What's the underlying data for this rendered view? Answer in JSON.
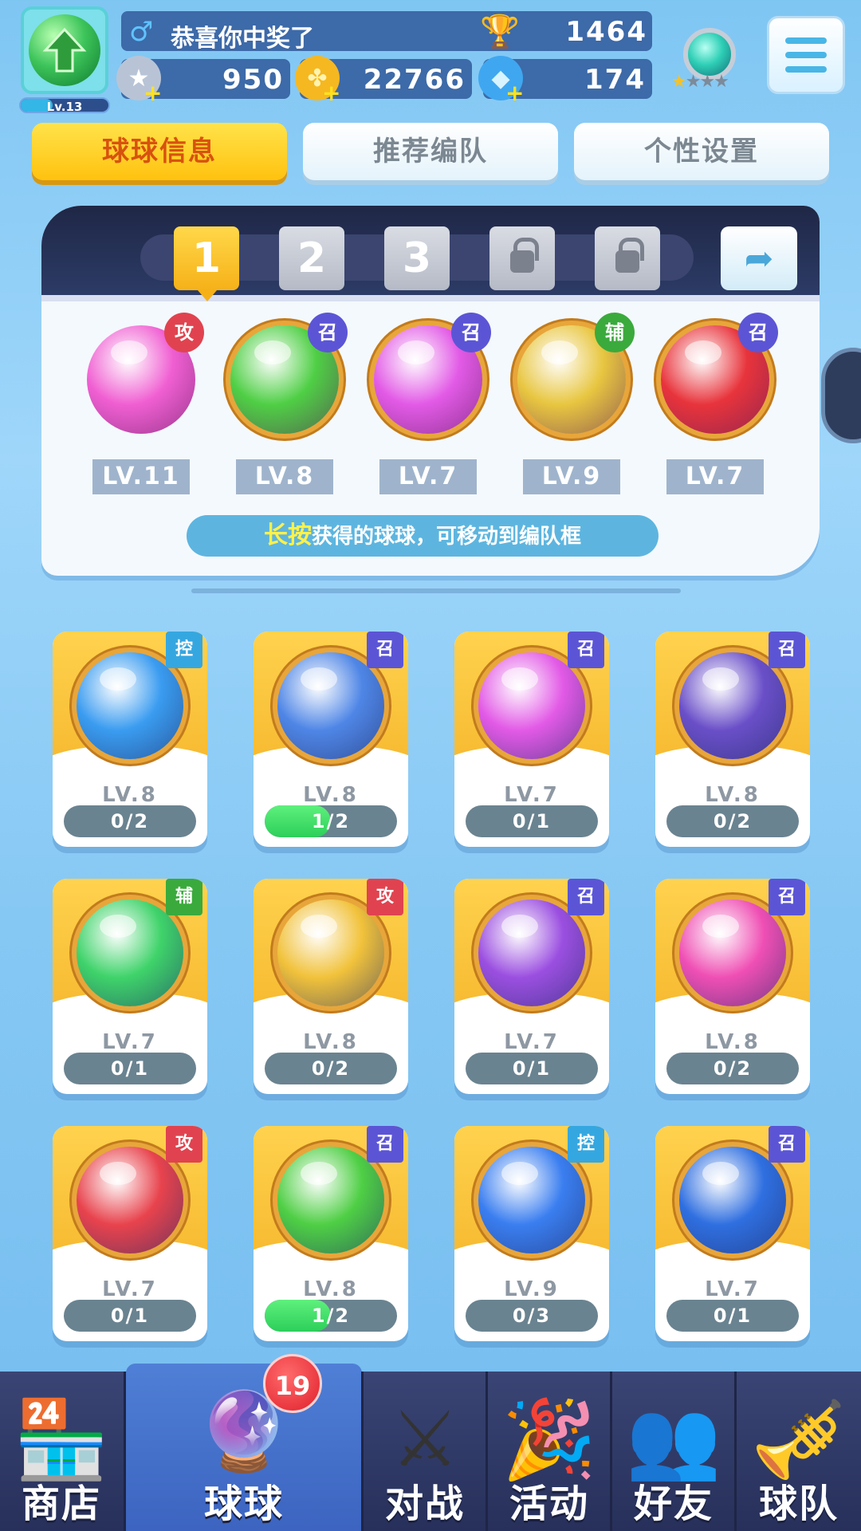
{
  "player": {
    "name": "恭喜你中奖了",
    "gender_symbol": "♂",
    "level": "Lv.13",
    "trophies": "1464"
  },
  "resources": [
    {
      "name": "silver-coin",
      "value": "950",
      "color": "#b8c4d6"
    },
    {
      "name": "gold-clover",
      "value": "22766",
      "color": "#f6b820"
    },
    {
      "name": "diamond",
      "value": "174",
      "color": "#3fa7f0"
    }
  ],
  "rank": {
    "stars_on": 1,
    "stars_total": 4
  },
  "tabs": [
    {
      "label": "球球信息",
      "active": true
    },
    {
      "label": "推荐编队",
      "active": false
    },
    {
      "label": "个性设置",
      "active": false
    }
  ],
  "team": {
    "slots": [
      {
        "label": "1",
        "state": "active"
      },
      {
        "label": "2",
        "state": "open"
      },
      {
        "label": "3",
        "state": "open"
      },
      {
        "label": "",
        "state": "locked"
      },
      {
        "label": "",
        "state": "locked"
      }
    ],
    "balls": [
      {
        "level": "LV.11",
        "tag": "攻",
        "tag_color": "#e0434f",
        "orb_color": "#f05fd2",
        "icon": "shield-icon"
      },
      {
        "level": "LV.8",
        "tag": "召",
        "tag_color": "#5b55d6",
        "orb_color": "#4fcf45",
        "icon": "star-circle-icon"
      },
      {
        "level": "LV.7",
        "tag": "召",
        "tag_color": "#5b55d6",
        "orb_color": "#e25ae6",
        "icon": "mushroom-cloud-icon"
      },
      {
        "level": "LV.9",
        "tag": "辅",
        "tag_color": "#3aaa3c",
        "orb_color": "#e8c640",
        "icon": "pumpkin-icon"
      },
      {
        "level": "LV.7",
        "tag": "召",
        "tag_color": "#5b55d6",
        "orb_color": "#e8343c",
        "icon": "cannon-icon"
      }
    ],
    "tip_highlight": "长按",
    "tip_text": "获得的球球，可移动到编队框"
  },
  "collection": [
    {
      "level": "LV.8",
      "progress": "0/2",
      "fill": 0,
      "tag": "控",
      "tag_color": "#35a7e0",
      "orb_color": "#3a9cf0",
      "icon": "wave-icon"
    },
    {
      "level": "LV.8",
      "progress": "1/2",
      "fill": 0.5,
      "tag": "召",
      "tag_color": "#5b55d6",
      "orb_color": "#4f86e6",
      "icon": "whirlwind-icon"
    },
    {
      "level": "LV.7",
      "progress": "0/1",
      "fill": 0,
      "tag": "召",
      "tag_color": "#5b55d6",
      "orb_color": "#e25ae6",
      "icon": "mushroom-cloud-icon"
    },
    {
      "level": "LV.8",
      "progress": "0/2",
      "fill": 0,
      "tag": "召",
      "tag_color": "#5b55d6",
      "orb_color": "#6a4fc8",
      "icon": "ghost-icon"
    },
    {
      "level": "LV.7",
      "progress": "0/1",
      "fill": 0,
      "tag": "辅",
      "tag_color": "#3aaa3c",
      "orb_color": "#3fd36a",
      "icon": "arrow-up-icon"
    },
    {
      "level": "LV.8",
      "progress": "0/2",
      "fill": 0,
      "tag": "攻",
      "tag_color": "#e0434f",
      "orb_color": "#f1c23b",
      "icon": "shuriken-icon"
    },
    {
      "level": "LV.7",
      "progress": "0/1",
      "fill": 0,
      "tag": "召",
      "tag_color": "#5b55d6",
      "orb_color": "#9b4fe0",
      "icon": "planet-icon"
    },
    {
      "level": "LV.8",
      "progress": "0/2",
      "fill": 0,
      "tag": "召",
      "tag_color": "#5b55d6",
      "orb_color": "#ef4fb4",
      "icon": "dagger-icon"
    },
    {
      "level": "LV.7",
      "progress": "0/1",
      "fill": 0,
      "tag": "攻",
      "tag_color": "#e0434f",
      "orb_color": "#e8434d",
      "icon": "fist-icon"
    },
    {
      "level": "LV.8",
      "progress": "1/2",
      "fill": 0.5,
      "tag": "召",
      "tag_color": "#5b55d6",
      "orb_color": "#4fcf45",
      "icon": "star-circle-icon"
    },
    {
      "level": "LV.9",
      "progress": "0/3",
      "fill": 0,
      "tag": "控",
      "tag_color": "#35a7e0",
      "orb_color": "#3a7ef0",
      "icon": "snowflake-icon"
    },
    {
      "level": "LV.7",
      "progress": "0/1",
      "fill": 0,
      "tag": "召",
      "tag_color": "#5b55d6",
      "orb_color": "#2f6fe0",
      "icon": "ice-wall-icon"
    }
  ],
  "nav": {
    "items": [
      {
        "label": "商店",
        "icon": "🏪",
        "icon_name": "shop-icon",
        "active": false
      },
      {
        "label": "球球",
        "icon": "🔮",
        "icon_name": "balls-icon",
        "active": true
      },
      {
        "label": "对战",
        "icon": "⚔",
        "icon_name": "crossed-swords-icon",
        "active": false
      },
      {
        "label": "活动",
        "icon": "🎉",
        "icon_name": "party-popper-icon",
        "active": false
      },
      {
        "label": "好友",
        "icon": "👥",
        "icon_name": "friends-book-icon",
        "active": false
      },
      {
        "label": "球队",
        "icon": "🎺",
        "icon_name": "whistle-icon",
        "active": false
      }
    ],
    "badge": "19"
  }
}
